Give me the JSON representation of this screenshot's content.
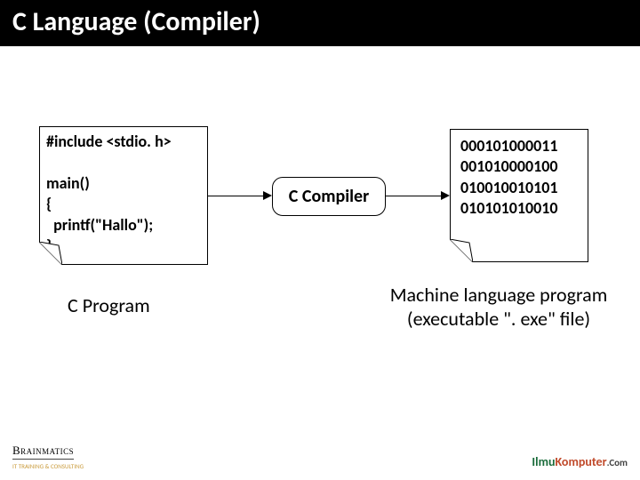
{
  "title": "C Language (Compiler)",
  "code": {
    "line1": "#include <stdio. h>",
    "blank": "",
    "line2": "main()",
    "line3": "{",
    "line4": "  printf(\"Hallo\");",
    "line5": "}"
  },
  "compiler_label": "C Compiler",
  "binary": {
    "line1": "000101000011",
    "line2": "001010000100",
    "line3": "010010010101",
    "line4": "010101010010"
  },
  "left_label": "C Program",
  "right_label_line1": "Machine language program",
  "right_label_line2": "(executable \". exe\" file)",
  "logo_left_top": "Brainmatics",
  "logo_left_sub": "IT TRAINING & CONSULTING",
  "logo_right_a": "Ilmu",
  "logo_right_b": "Komputer",
  "logo_right_c": ".Com",
  "logo_right_sub": ""
}
